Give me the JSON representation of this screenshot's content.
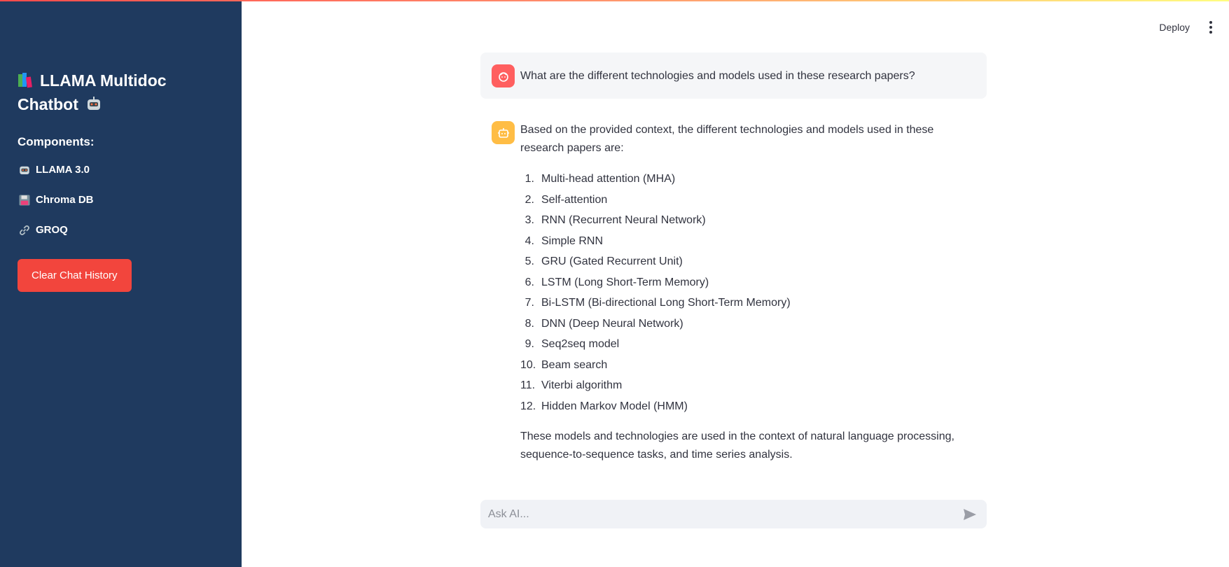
{
  "sidebar": {
    "title": "LLAMA Multidoc Chatbot",
    "components_heading": "Components:",
    "components": [
      {
        "icon": "robot-icon",
        "label": "LLAMA 3.0"
      },
      {
        "icon": "floppy-disk-icon",
        "label": "Chroma DB"
      },
      {
        "icon": "link-icon",
        "label": "GROQ"
      }
    ],
    "clear_button": "Clear Chat History"
  },
  "header": {
    "deploy_label": "Deploy",
    "menu_icon": "kebab-menu-icon"
  },
  "chat": {
    "user_message": "What are the different technologies and models used in these research papers?",
    "ai_intro": "Based on the provided context, the different technologies and models used in these research papers are:",
    "ai_list": [
      {
        "num": "1.",
        "text": "Multi-head attention (MHA)"
      },
      {
        "num": "2.",
        "text": "Self-attention"
      },
      {
        "num": "3.",
        "text": "RNN (Recurrent Neural Network)"
      },
      {
        "num": "4.",
        "text": "Simple RNN"
      },
      {
        "num": "5.",
        "text": "GRU (Gated Recurrent Unit)"
      },
      {
        "num": "6.",
        "text": "LSTM (Long Short-Term Memory)"
      },
      {
        "num": "7.",
        "text": "Bi-LSTM (Bi-directional Long Short-Term Memory)"
      },
      {
        "num": "8.",
        "text": "DNN (Deep Neural Network)"
      },
      {
        "num": "9.",
        "text": "Seq2seq model"
      },
      {
        "num": "10.",
        "text": "Beam search"
      },
      {
        "num": "11.",
        "text": "Viterbi algorithm"
      },
      {
        "num": "12.",
        "text": "Hidden Markov Model (HMM)"
      }
    ],
    "ai_outro": "These models and technologies are used in the context of natural language processing, sequence-to-sequence tasks, and time series analysis."
  },
  "input": {
    "placeholder": "Ask AI..."
  },
  "colors": {
    "sidebar_bg": "#1f3a5f",
    "clear_button": "#f2453d",
    "user_avatar": "#ff5f5f",
    "ai_avatar": "#ffbd45"
  }
}
